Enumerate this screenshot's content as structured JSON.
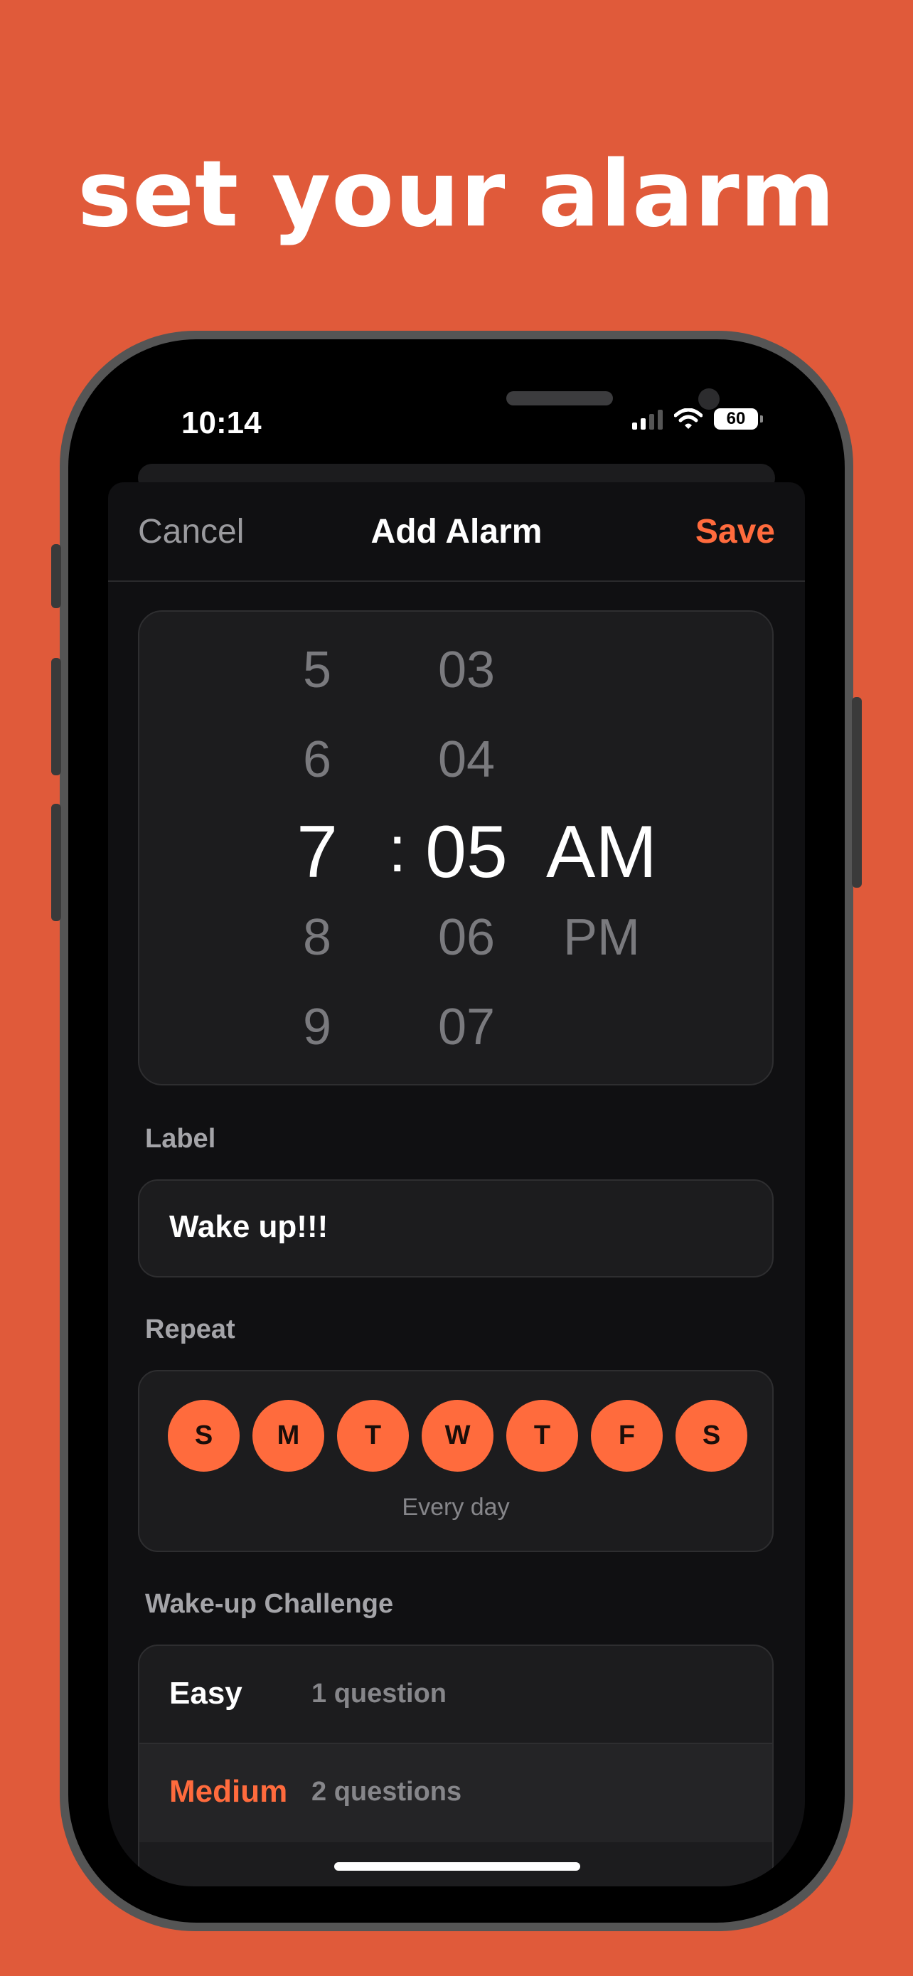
{
  "headline": "set your alarm",
  "status_bar": {
    "time": "10:14",
    "battery": "60"
  },
  "navbar": {
    "cancel": "Cancel",
    "title": "Add Alarm",
    "save": "Save"
  },
  "time_picker": {
    "hours": [
      "5",
      "6",
      "7",
      "8",
      "9"
    ],
    "separator": ":",
    "minutes": [
      "03",
      "04",
      "05",
      "06",
      "07"
    ],
    "periods": [
      "AM",
      "PM"
    ],
    "selected": {
      "hour": "7",
      "minute": "05",
      "period": "AM"
    }
  },
  "label_section": {
    "heading": "Label",
    "value": "Wake up!!!"
  },
  "repeat_section": {
    "heading": "Repeat",
    "days": [
      "S",
      "M",
      "T",
      "W",
      "T",
      "F",
      "S"
    ],
    "summary": "Every day"
  },
  "challenge_section": {
    "heading": "Wake-up Challenge",
    "options": [
      {
        "name": "Easy",
        "desc": "1 question"
      },
      {
        "name": "Medium",
        "desc": "2 questions"
      }
    ],
    "selected": "Medium"
  },
  "colors": {
    "accent": "#FF6B3D",
    "background": "#E05A3A",
    "sheet": "#101012"
  }
}
